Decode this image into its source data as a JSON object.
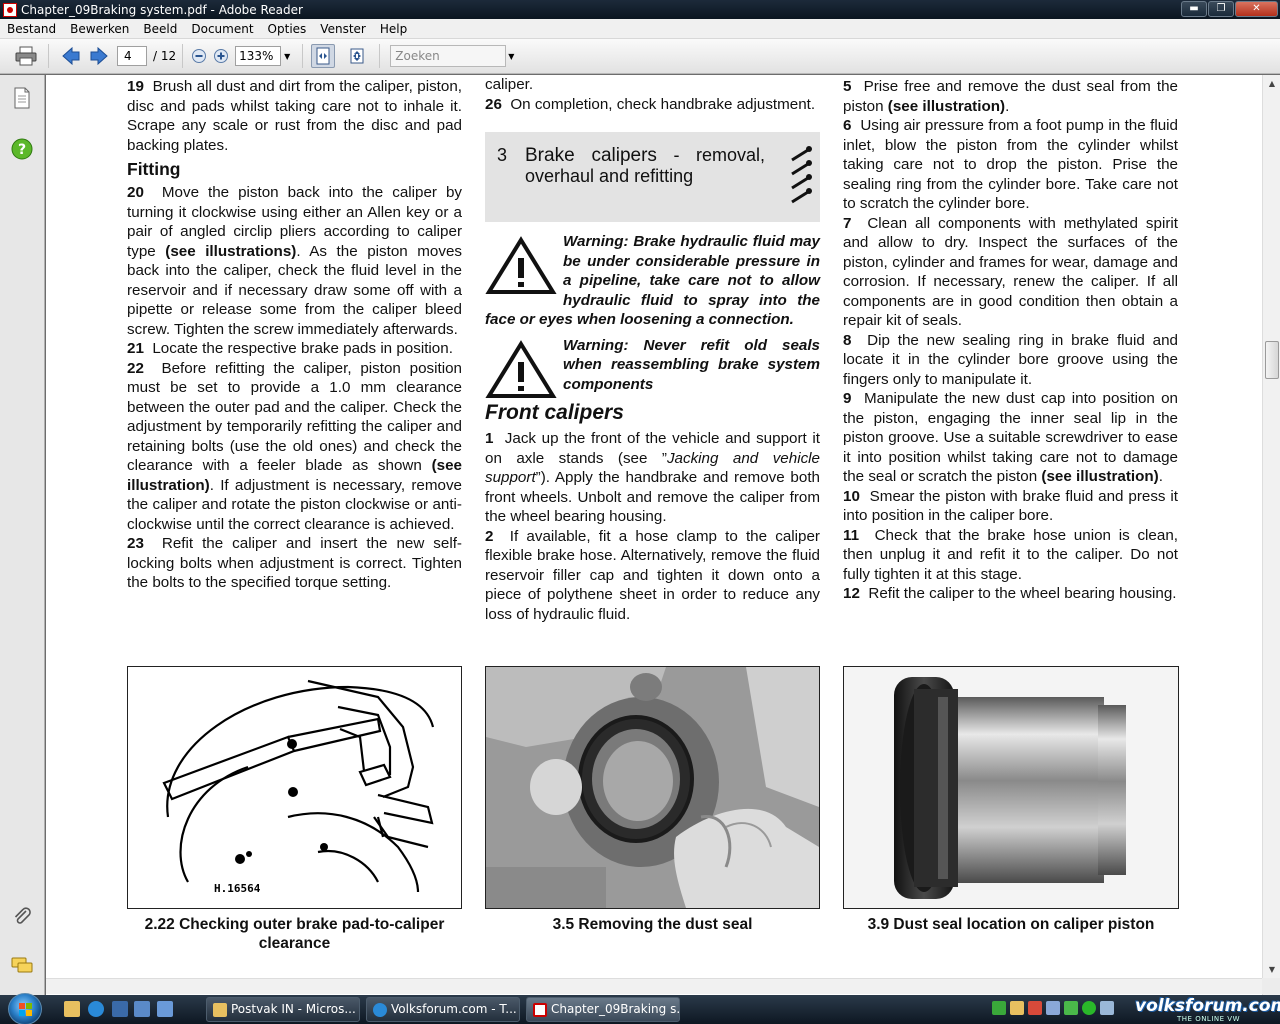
{
  "window": {
    "title": "Chapter_09Braking system.pdf - Adobe Reader"
  },
  "menu": [
    "Bestand",
    "Bewerken",
    "Beeld",
    "Document",
    "Opties",
    "Venster",
    "Help"
  ],
  "toolbar": {
    "page_current": "4",
    "page_total": "/ 12",
    "zoom": "133%",
    "search_placeholder": "Zoeken"
  },
  "doc": {
    "col1": {
      "p19_num": "19",
      "p19": "Brush all dust and dirt from the caliper, piston, disc and pads whilst taking care not to inhale it. Scrape any scale or rust from the disc and pad backing plates.",
      "fitting": "Fitting",
      "p20_num": "20",
      "p20a": "Move the piston back into the caliper by turning it clockwise using either an Allen key or a pair of angled circlip pliers according to caliper type",
      "p20_ref": "(see illustrations)",
      "p20b": ". As the piston moves back into the caliper, check the fluid level in the reservoir and if necessary draw some off with a pipette or release some from the caliper bleed screw. Tighten the screw immediately afterwards.",
      "p21_num": "21",
      "p21": "Locate the respective brake pads in position.",
      "p22_num": "22",
      "p22a": "Before refitting the caliper, piston position must be set to provide a 1.0 mm clearance between the outer pad and the caliper. Check the adjustment by temporarily refitting the caliper and retaining bolts (use the old ones) and check the clearance with a feeler blade as shown",
      "p22_ref": "(see illustration)",
      "p22b": ". If adjustment is necessary, remove the caliper and rotate the piston clockwise or anti-clockwise until the correct clearance is achieved.",
      "p23_num": "23",
      "p23": "Refit the caliper and insert the new self-locking bolts when adjustment is correct. Tighten the bolts to the specified torque setting."
    },
    "col2": {
      "cont": "caliper.",
      "p26_num": "26",
      "p26": "On completion, check handbrake adjustment.",
      "section_num": "3",
      "section_title_bold": "Brake calipers",
      "section_title_rest": " - removal, overhaul and refitting",
      "warn1": "Warning: Brake hydraulic fluid may be under considerable pressure in a pipeline, take care not to allow hydraulic fluid to spray into the face or eyes when loosening a connection.",
      "warn2": "Warning: Never refit old seals when reassembling brake system components",
      "front_head": "Front calipers",
      "p1_num": "1",
      "p1a": "Jack up the front of the vehicle and support it on axle stands (see ”",
      "p1_italic": "Jacking and vehicle support",
      "p1b": "”). Apply the handbrake and remove both front wheels. Unbolt and remove the caliper from the wheel bearing housing.",
      "p2_num": "2",
      "p2": "If available, fit a hose clamp to the caliper flexible brake hose. Alternatively, remove the fluid reservoir filler cap and tighten it down onto a piece of polythene sheet in order to reduce any loss of hydraulic fluid."
    },
    "col3": {
      "p5_num": "5",
      "p5a": "Prise free and remove the dust seal from the piston",
      "p5_ref": "(see illustration)",
      "p5b": ".",
      "p6_num": "6",
      "p6": "Using air pressure from a foot pump in the fluid inlet, blow the piston from the cylinder whilst taking care not to drop the piston. Prise the sealing ring from the cylinder bore. Take care not to scratch the cylinder bore.",
      "p7_num": "7",
      "p7": "Clean all components with methylated spirit and allow to dry. Inspect the surfaces of the piston, cylinder and frames for wear, damage and corrosion. If necessary, renew the caliper. If all components are in good condition then obtain a repair kit of seals.",
      "p8_num": "8",
      "p8": "Dip the new sealing ring in brake fluid and locate it in the cylinder bore groove using the fingers only to manipulate it.",
      "p9_num": "9",
      "p9a": "Manipulate the new dust cap into position on the piston, engaging the inner seal lip in the piston groove. Use a suitable screwdriver to ease it into position whilst taking care not to damage the seal or scratch the piston",
      "p9_ref": "(see illustration)",
      "p9b": ".",
      "p10_num": "10",
      "p10": "Smear the piston with brake fluid and press it into position in the caliper bore.",
      "p11_num": "11",
      "p11": "Check that the brake hose union is clean, then unplug it and refit it to the caliper. Do not fully tighten it at this stage.",
      "p12_num": "12",
      "p12": "Refit the caliper to the wheel bearing housing."
    },
    "figures": [
      {
        "label": "H.16564",
        "caption": "2.22  Checking outer brake pad-to-caliper clearance"
      },
      {
        "caption": "3.5  Removing the dust seal"
      },
      {
        "caption": "3.9  Dust seal location on caliper piston"
      }
    ]
  },
  "taskbar": {
    "tasks": [
      {
        "label": "Postvak IN - Micros..."
      },
      {
        "label": "Volksforum.com - T..."
      },
      {
        "label": "Chapter_09Braking s..."
      }
    ],
    "watermark": "volksforum.com",
    "watermark_sub": "THE ONLINE VW COMMUNITY"
  },
  "colors": {
    "section_bg": "#e3e3e3",
    "taskbar": "#1a2633",
    "accent_blue": "#2a7fc8"
  }
}
